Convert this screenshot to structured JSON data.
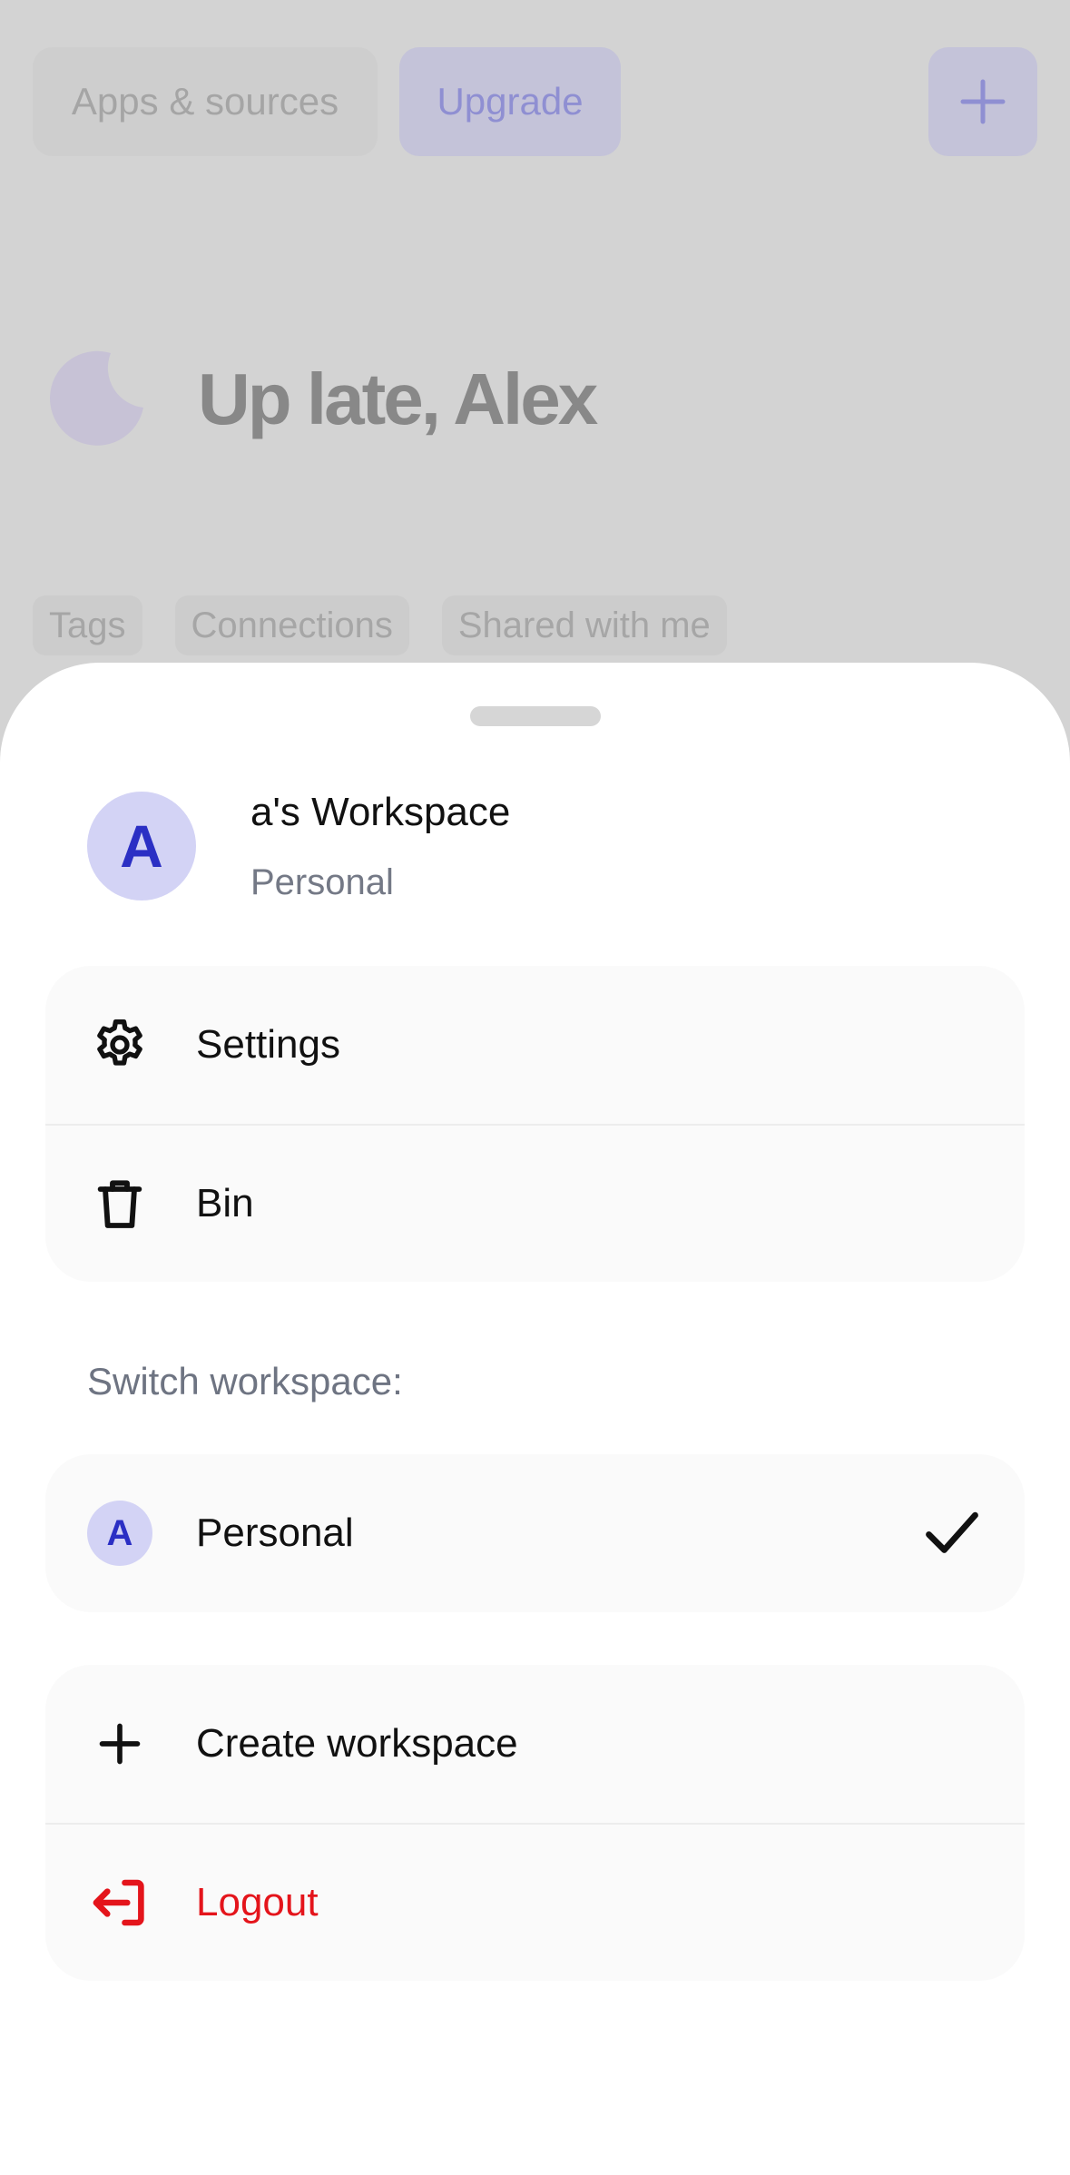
{
  "background": {
    "top_bar": {
      "apps_label": "Apps & sources",
      "upgrade_label": "Upgrade",
      "add_icon": "plus-icon"
    },
    "greeting": {
      "icon": "moon-icon",
      "title": "Up late, Alex"
    },
    "filters": [
      "Tags",
      "Connections",
      "Shared with me"
    ]
  },
  "sheet": {
    "workspace": {
      "avatar_letter": "A",
      "name": "a's Workspace",
      "type": "Personal"
    },
    "menu": [
      {
        "label": "Settings",
        "icon": "gear-icon"
      },
      {
        "label": "Bin",
        "icon": "trash-icon"
      }
    ],
    "switch_label": "Switch workspace:",
    "workspaces": [
      {
        "avatar_letter": "A",
        "label": "Personal",
        "selected": true
      }
    ],
    "actions": [
      {
        "label": "Create workspace",
        "icon": "plus-icon"
      },
      {
        "label": "Logout",
        "icon": "logout-icon",
        "color": "#e4141b"
      }
    ]
  },
  "colors": {
    "accent": "#2b2fc4",
    "avatar_bg": "#d3d3f5",
    "danger": "#e4141b",
    "overlay": "#d3d3d3"
  }
}
